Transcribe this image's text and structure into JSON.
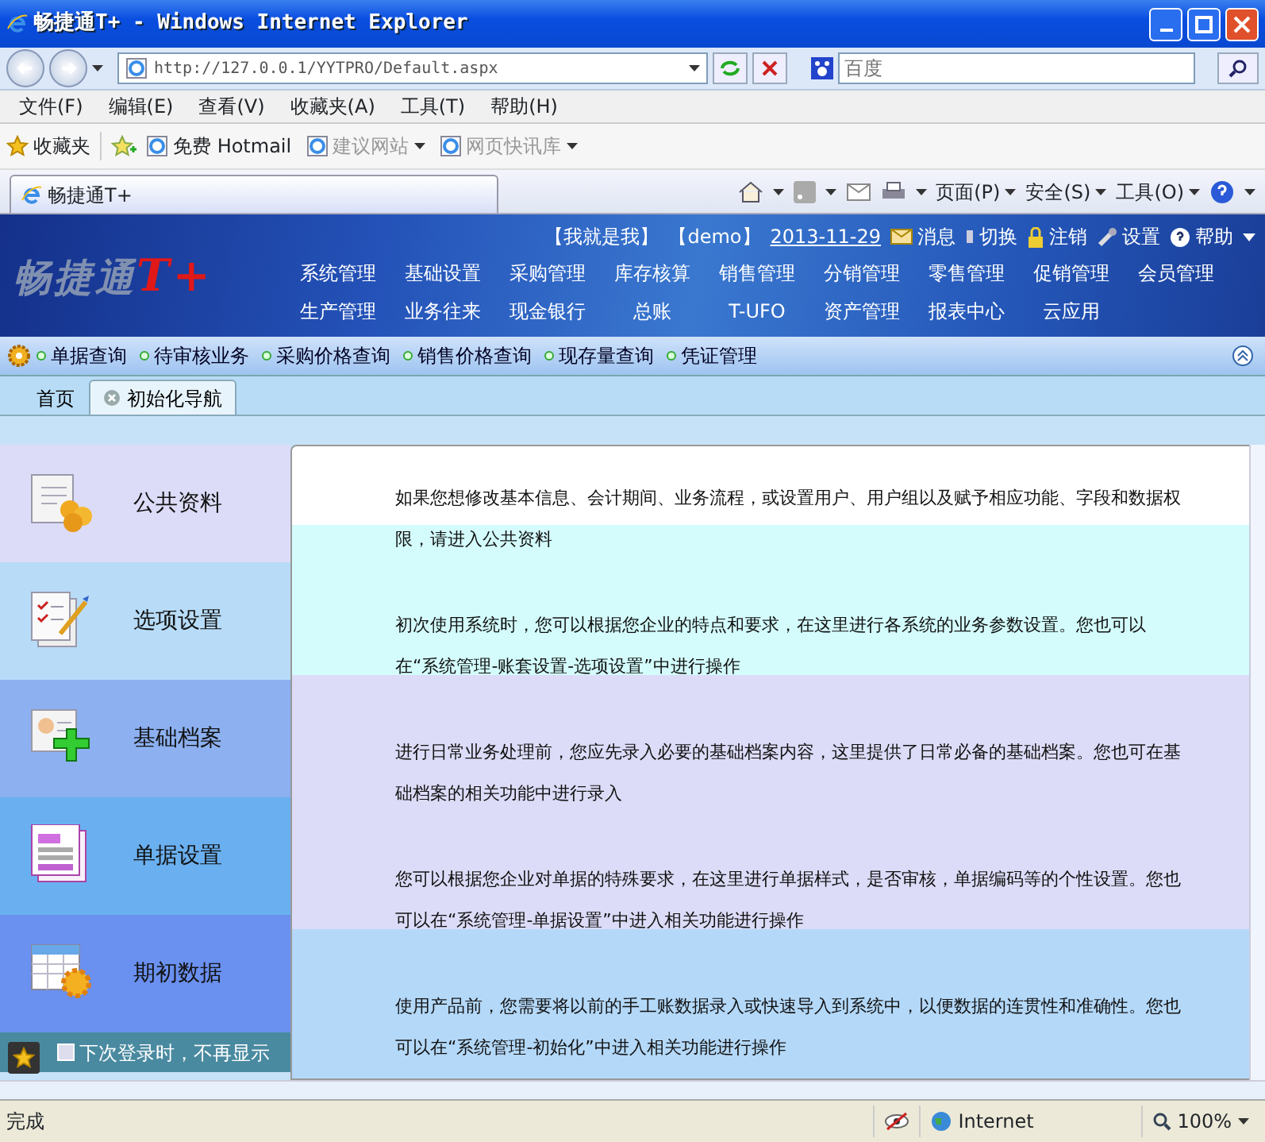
{
  "window": {
    "title": "畅捷通T+ - Windows Internet Explorer"
  },
  "browser": {
    "address": "http://127.0.0.1/YYTPRO/Default.aspx",
    "search_placeholder": "百度",
    "menu": [
      "文件(F)",
      "编辑(E)",
      "查看(V)",
      "收藏夹(A)",
      "工具(T)",
      "帮助(H)"
    ],
    "favorites_label": "收藏夹",
    "favorites": [
      {
        "label": "免费 Hotmail",
        "dropdown": false,
        "disabled": false
      },
      {
        "label": "建议网站",
        "dropdown": true,
        "disabled": true
      },
      {
        "label": "网页快讯库",
        "dropdown": true,
        "disabled": true
      }
    ],
    "tab": "畅捷通T+",
    "commands": [
      "页面(P)",
      "安全(S)",
      "工具(O)"
    ]
  },
  "app": {
    "logo_name": "畅捷通",
    "logo_mark": "T+",
    "user": "【我就是我】",
    "account": "【demo】",
    "date": "2013-11-29",
    "actions": [
      "消息",
      "切换",
      "注销",
      "设置",
      "帮助"
    ],
    "modules": [
      [
        "系统管理",
        "基础设置",
        "采购管理",
        "库存核算",
        "销售管理",
        "分销管理",
        "零售管理",
        "促销管理",
        "会员管理"
      ],
      [
        "生产管理",
        "业务往来",
        "现金银行",
        "总账",
        "T-UFO",
        "资产管理",
        "报表中心",
        "云应用"
      ]
    ],
    "quick_links": [
      "单据查询",
      "待审核业务",
      "采购价格查询",
      "销售价格查询",
      "现存量查询",
      "凭证管理"
    ],
    "tabs": [
      {
        "label": "首页",
        "selected": false,
        "closable": false
      },
      {
        "label": "初始化导航",
        "selected": true,
        "closable": true
      }
    ],
    "sections": [
      {
        "title": "公共资料",
        "description": "如果您想修改基本信息、会计期间、业务流程，或设置用户、用户组以及赋予相应功能、字段和数据权限，请进入公共资料"
      },
      {
        "title": "选项设置",
        "description": "初次使用系统时，您可以根据您企业的特点和要求，在这里进行各系统的业务参数设置。您也可以在“系统管理-账套设置-选项设置”中进行操作"
      },
      {
        "title": "基础档案",
        "description": "进行日常业务处理前，您应先录入必要的基础档案内容，这里提供了日常必备的基础档案。您也可在基础档案的相关功能中进行录入"
      },
      {
        "title": "单据设置",
        "description": "您可以根据您企业对单据的特殊要求，在这里进行单据样式，是否审核，单据编码等的个性设置。您也可以在“系统管理-单据设置”中进入相关功能进行操作"
      },
      {
        "title": "期初数据",
        "description": "使用产品前，您需要将以前的手工账数据录入或快速导入到系统中，以便数据的连贯性和准确性。您也可以在“系统管理-初始化”中进入相关功能进行操作"
      }
    ],
    "dont_show_again": {
      "label": "下次登录时，不再显示",
      "checked": false
    }
  },
  "status_bar": {
    "text": "完成",
    "zone": "Internet",
    "zoom": "100%"
  }
}
